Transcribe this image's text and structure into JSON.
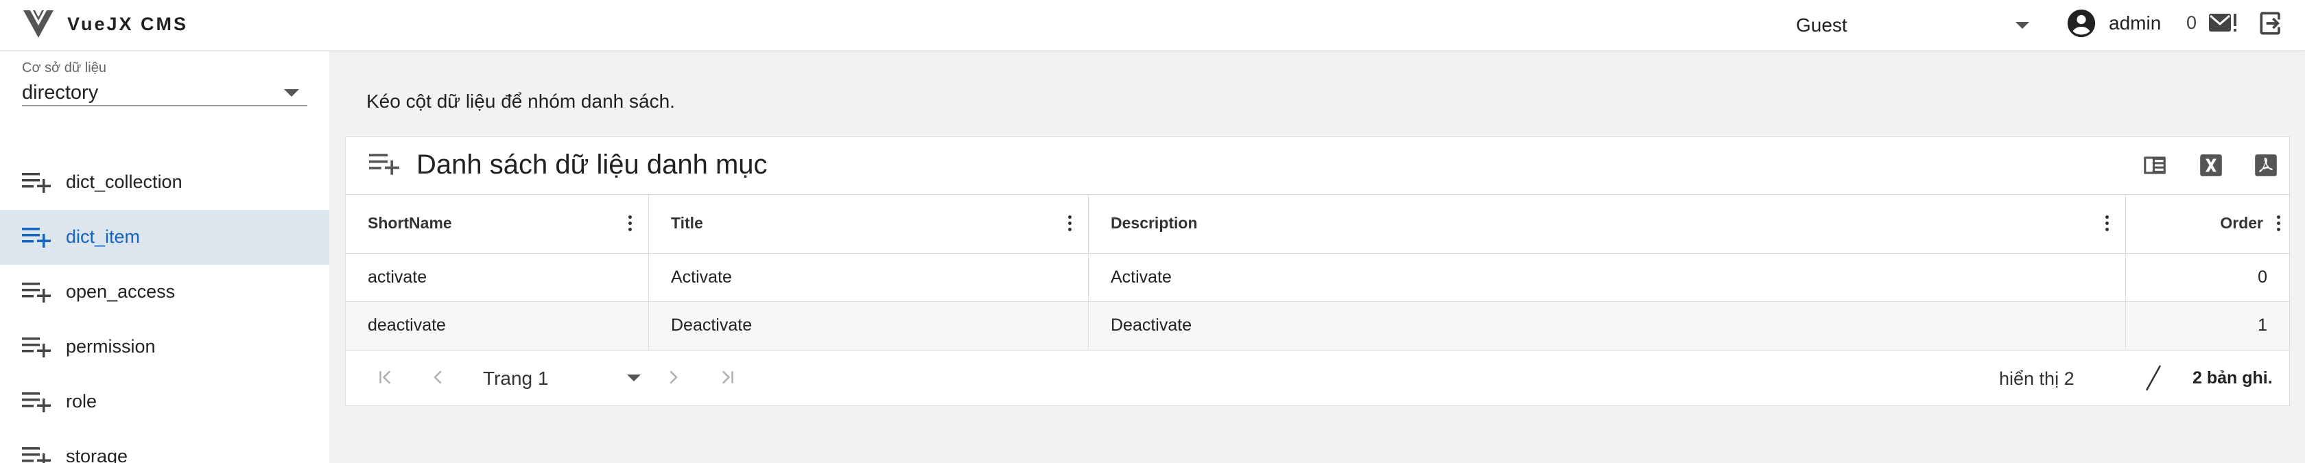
{
  "app": {
    "title": "VueJX CMS"
  },
  "header": {
    "role": "Guest",
    "user": "admin",
    "messages": "0"
  },
  "sidebar": {
    "db_label": "Cơ sở dữ liệu",
    "db_value": "directory",
    "items": [
      {
        "label": "dict_collection",
        "active": false
      },
      {
        "label": "dict_item",
        "active": true
      },
      {
        "label": "open_access",
        "active": false
      },
      {
        "label": "permission",
        "active": false
      },
      {
        "label": "role",
        "active": false
      },
      {
        "label": "storage",
        "active": false
      }
    ]
  },
  "main": {
    "hint": "Kéo cột dữ liệu để nhóm danh sách.",
    "title": "Danh sách dữ liệu danh mục",
    "columns": [
      "ShortName",
      "Title",
      "Description",
      "Order"
    ],
    "rows": [
      [
        "activate",
        "Activate",
        "Activate",
        "0"
      ],
      [
        "deactivate",
        "Deactivate",
        "Deactivate",
        "1"
      ]
    ]
  },
  "pager": {
    "page": "Trang 1",
    "shown": "hiển thị 2",
    "total": "2 bản ghi."
  },
  "colors": {
    "accent": "#1565c0",
    "active_bg": "#dde6ef",
    "background": "#f2f2f2"
  }
}
